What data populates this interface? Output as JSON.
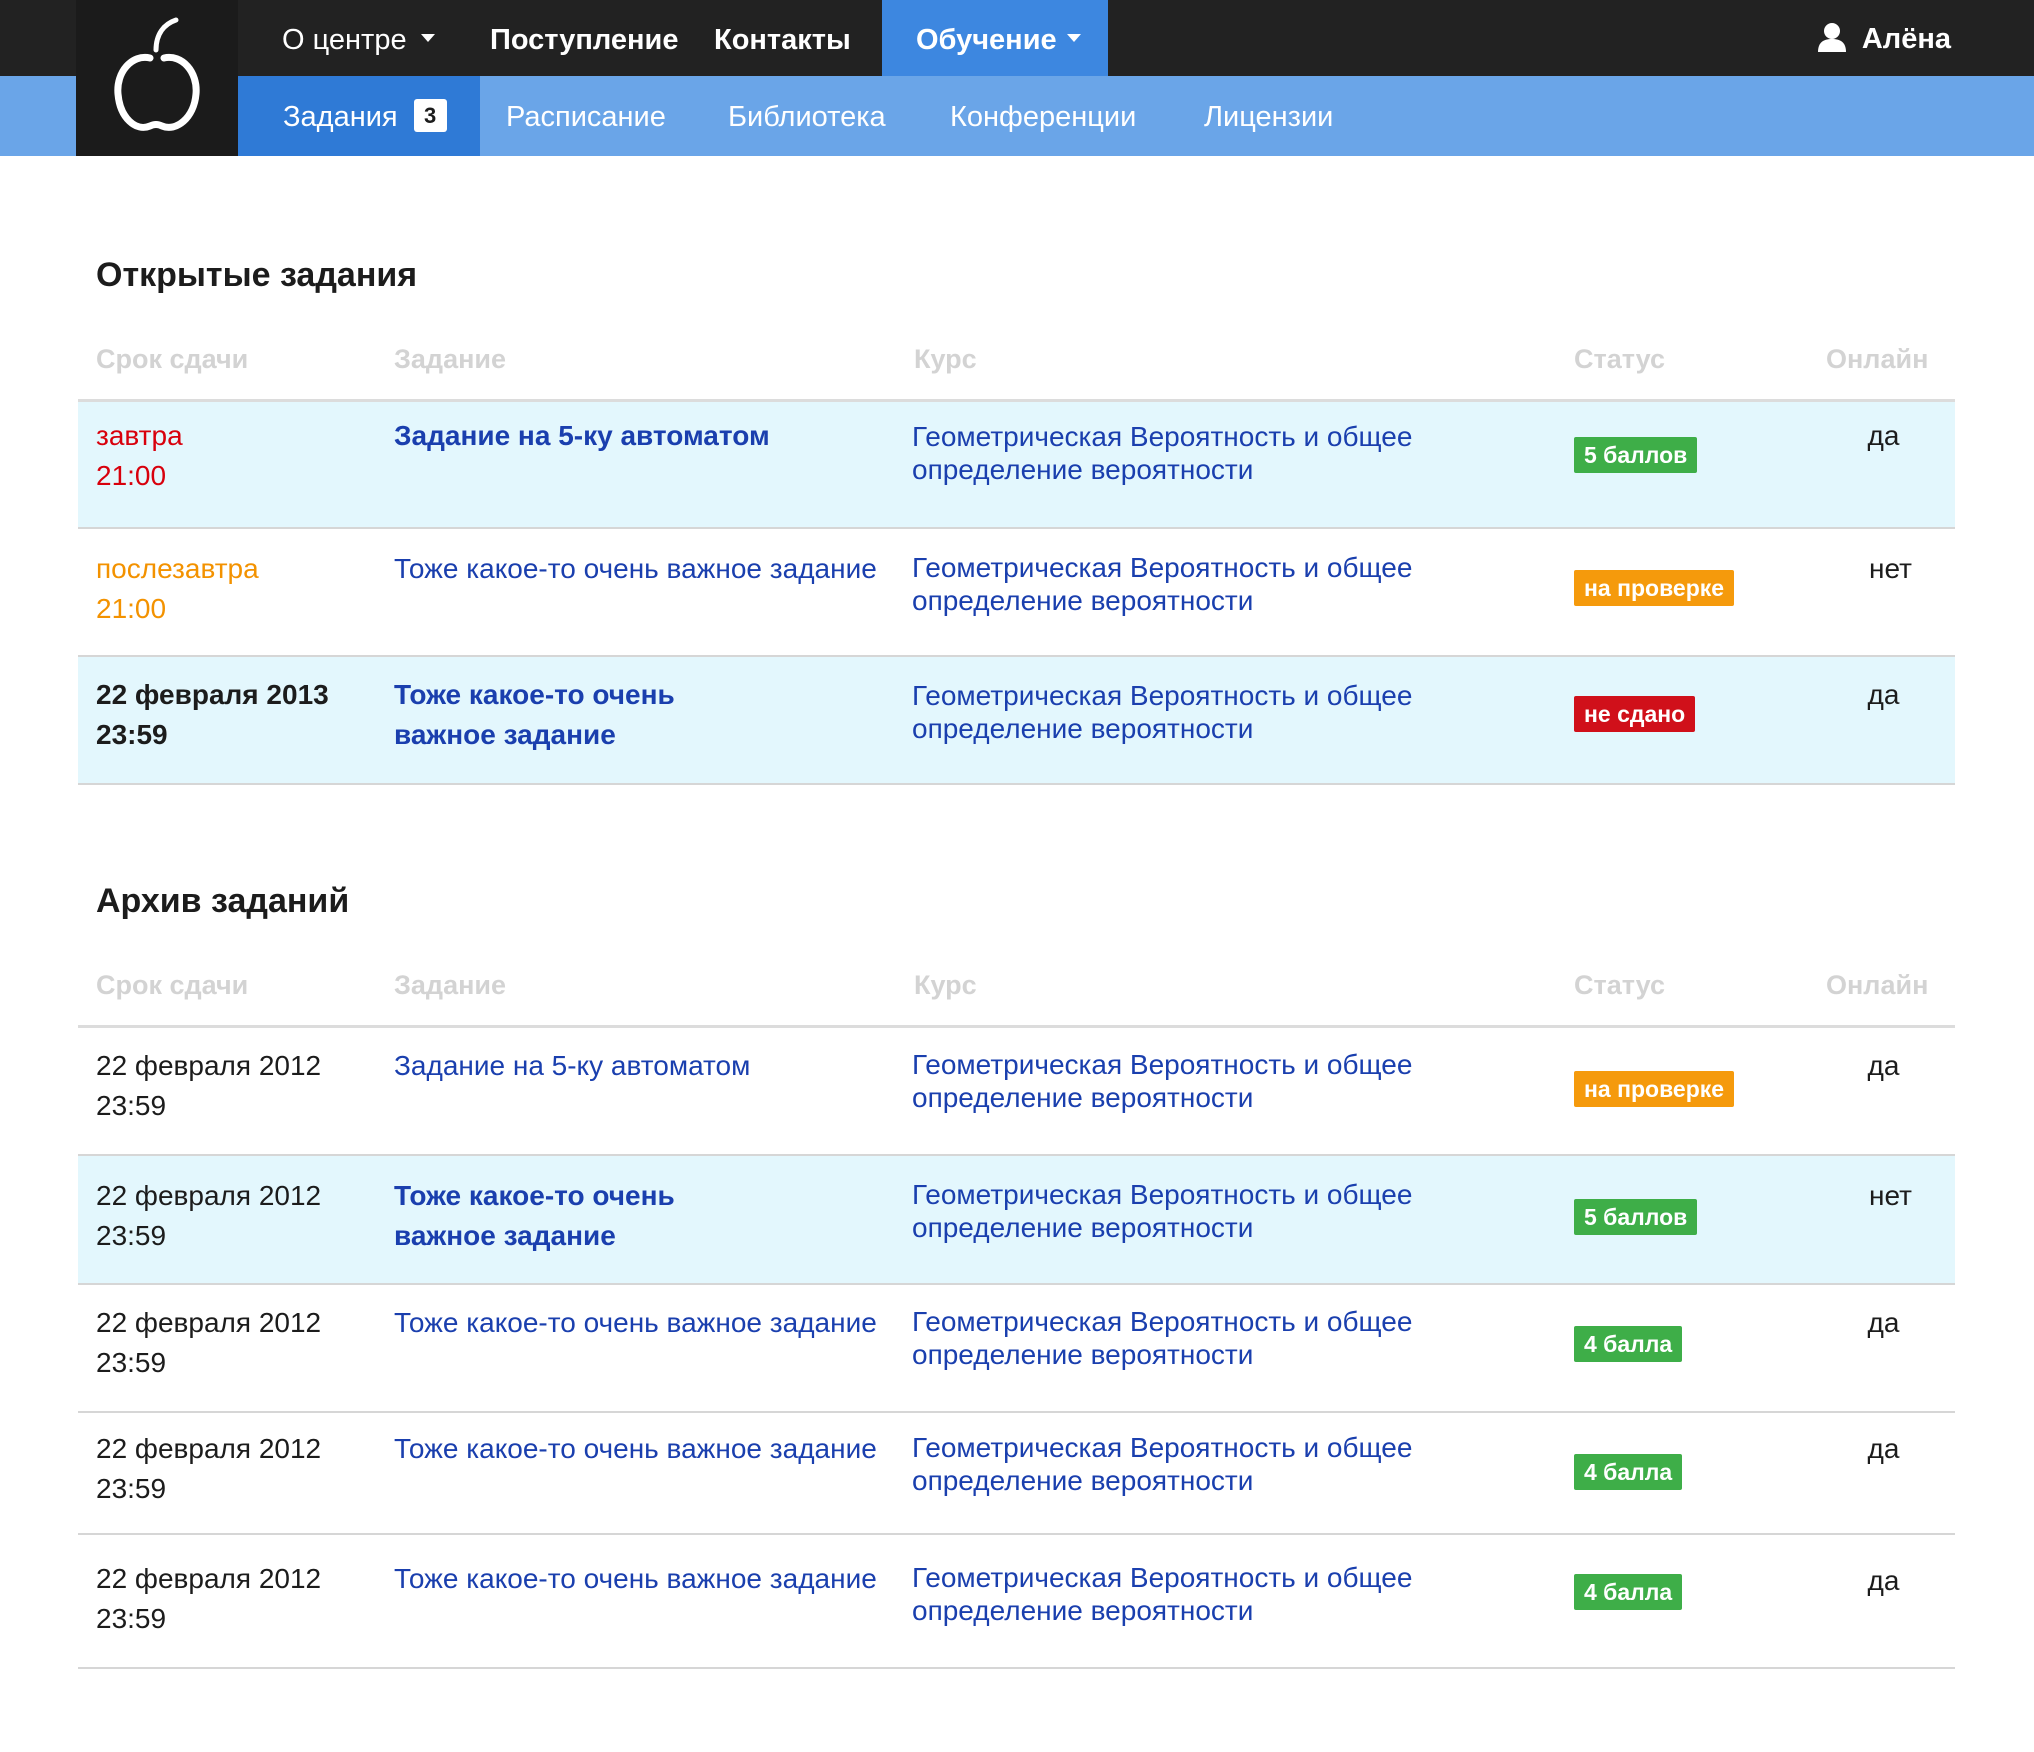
{
  "nav": {
    "top": [
      {
        "label": "О центре",
        "dropdown": true
      },
      {
        "label": "Поступление"
      },
      {
        "label": "Контакты"
      },
      {
        "label": "Обучение",
        "dropdown": true,
        "active": true
      }
    ],
    "user": "Алёна",
    "sub": [
      {
        "label": "Задания",
        "badge": "3",
        "active": true
      },
      {
        "label": "Расписание"
      },
      {
        "label": "Библиотека"
      },
      {
        "label": "Конференции"
      },
      {
        "label": "Лицензии"
      }
    ]
  },
  "columns": {
    "date": "Срок сдачи",
    "task": "Задание",
    "course": "Курс",
    "status": "Статус",
    "online": "Онлайн"
  },
  "open": {
    "title": "Открытые задания",
    "rows": [
      {
        "date": "завтра",
        "time": "21:00",
        "date_color": "red",
        "task": "Задание на 5-ку автоматом",
        "task_bold": true,
        "course_line1": "Геометрическая Вероятность и общее",
        "course_line2": "определение вероятности",
        "status": "5 баллов",
        "status_color": "green",
        "online": "да",
        "highlight": true
      },
      {
        "date": "послезавтра",
        "time": "21:00",
        "date_color": "orange",
        "task": "Тоже какое-то очень важное задание",
        "task_bold": false,
        "course_line1": "Геометрическая Вероятность и общее",
        "course_line2": "определение вероятности",
        "status": "на проверке",
        "status_color": "orange",
        "online": "нет",
        "highlight": false
      },
      {
        "date": "22 февраля 2013",
        "time": "23:59",
        "date_color": "bold",
        "task": "Тоже какое-то очень важное задание",
        "task_bold": true,
        "course_line1": "Геометрическая Вероятность и общее",
        "course_line2": "определение вероятности",
        "status": "не сдано",
        "status_color": "red",
        "online": "да",
        "highlight": true
      }
    ]
  },
  "archive": {
    "title": "Архив заданий",
    "rows": [
      {
        "date": "22 февраля 2012",
        "time": "23:59",
        "task": "Задание на 5-ку автоматом",
        "task_bold": false,
        "course_line1": "Геометрическая Вероятность и общее",
        "course_line2": "определение вероятности",
        "status": "на проверке",
        "status_color": "orange",
        "online": "да",
        "highlight": false
      },
      {
        "date": "22 февраля 2012",
        "time": "23:59",
        "task": "Тоже какое-то очень важное задание",
        "task_bold": true,
        "course_line1": "Геометрическая Вероятность и общее",
        "course_line2": "определение вероятности",
        "status": "5 баллов",
        "status_color": "green",
        "online": "нет",
        "highlight": true
      },
      {
        "date": "22 февраля 2012",
        "time": "23:59",
        "task": "Тоже какое-то очень важное задание",
        "task_bold": false,
        "course_line1": "Геометрическая Вероятность и общее",
        "course_line2": "определение вероятности",
        "status": "4 балла",
        "status_color": "green",
        "online": "да",
        "highlight": false
      },
      {
        "date": "22 февраля 2012",
        "time": "23:59",
        "task": "Тоже какое-то очень важное задание",
        "task_bold": false,
        "course_line1": "Геометрическая Вероятность и общее",
        "course_line2": "определение вероятности",
        "status": "4 балла",
        "status_color": "green",
        "online": "да",
        "highlight": false
      },
      {
        "date": "22 февраля 2012",
        "time": "23:59",
        "task": "Тоже какое-то очень важное задание",
        "task_bold": false,
        "course_line1": "Геометрическая Вероятность и общее",
        "course_line2": "определение вероятности",
        "status": "4 балла",
        "status_color": "green",
        "online": "да",
        "highlight": false
      }
    ]
  },
  "colors": {
    "topbar": "#222222",
    "subbar": "#6aa5e8",
    "active_tab": "#3d87e0",
    "link": "#1a3fae",
    "highlight_row": "#e3f7fd",
    "status_green": "#3eae48",
    "status_orange": "#f59a0c",
    "status_red": "#d0101a",
    "date_red": "#d8000c",
    "date_orange": "#f39200"
  }
}
